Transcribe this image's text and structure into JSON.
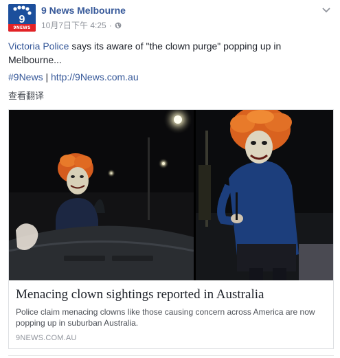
{
  "post": {
    "page_name": "9 News Melbourne",
    "timestamp": "10月7日下午 4:25",
    "meta_sep": "·",
    "logo_text": "9NEWS MELBOURNE",
    "text_link": "Victoria Police",
    "text_body": " says its aware of \"the clown purge\" popping up in Melbourne...",
    "hashtag": "#9News",
    "separator": "|",
    "url": "http://9News.com.au",
    "translate": "查看翻译"
  },
  "card": {
    "headline": "Menacing clown sightings reported in Australia",
    "description": "Police claim menacing clowns like those causing concern across America are now popping up in suburban Australia.",
    "domain": "9NEWS.COM.AU"
  },
  "colors": {
    "link": "#365899",
    "logo_blue": "#1c4f9c",
    "logo_red": "#e22226",
    "clown_hair": "#e8621c"
  }
}
